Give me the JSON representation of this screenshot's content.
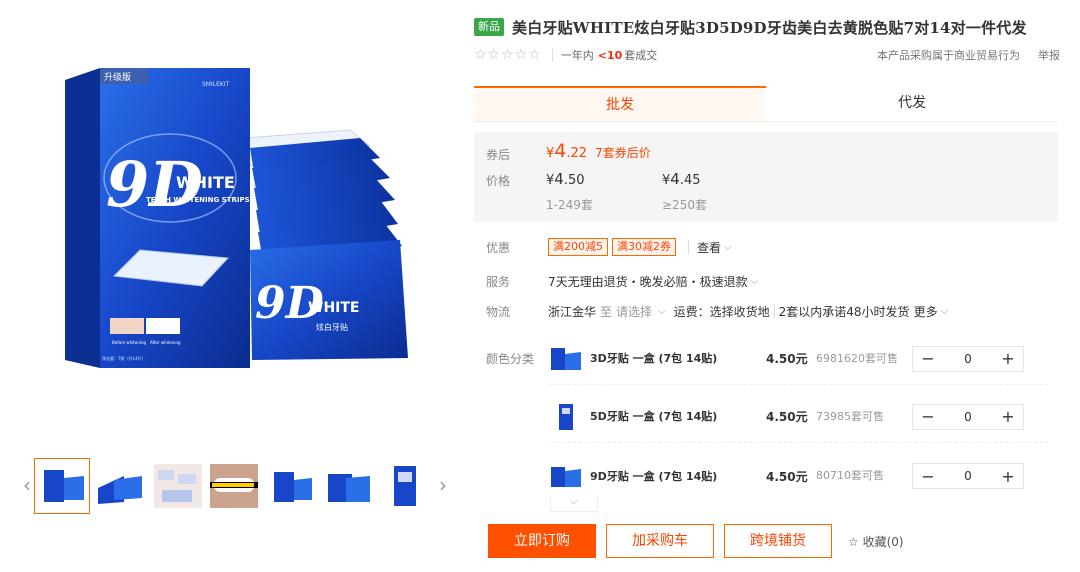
{
  "product": {
    "new_badge": "新品",
    "title": "美白牙贴WHITE炫白牙贴3D5D9D牙齿美白去黄脱色贴7对14对一件代发"
  },
  "rating": {
    "stars": "☆☆☆☆☆",
    "deals_prefix": "一年内",
    "deals_count": "<10",
    "deals_suffix": "套成交",
    "trade_note": "本产品采购属于商业贸易行为",
    "report": "举报"
  },
  "tabs": [
    {
      "label": "批发",
      "active": true
    },
    {
      "label": "代发",
      "active": false
    }
  ],
  "price": {
    "coupon_label": "券后",
    "coupon_currency": "¥",
    "coupon_int": "4",
    "coupon_dec": ".22",
    "coupon_note": "7套券后价",
    "price_label": "价格",
    "tiers": [
      {
        "currency": "¥",
        "int": "4",
        "dec": ".50",
        "qty": "1-249套"
      },
      {
        "currency": "¥",
        "int": "4",
        "dec": ".45",
        "qty": "≥250套"
      }
    ]
  },
  "promo": {
    "label": "优惠",
    "tags": [
      "满200减5",
      "满30减2券"
    ],
    "view": "查看"
  },
  "service": {
    "label": "服务",
    "text": "7天无理由退货・晚发必赔・极速退款"
  },
  "logistics": {
    "label": "物流",
    "origin": "浙江金华",
    "to": "至",
    "select": "请选择",
    "fee": "运费：选择收货地",
    "ship": "2套以内承诺48小时发货",
    "more": "更多"
  },
  "variants": {
    "label": "颜色分类",
    "items": [
      {
        "name": "3D牙贴 一盒 (7包 14贴)",
        "price": "4.50元",
        "stock": "6981620套可售",
        "qty": "0"
      },
      {
        "name": "5D牙贴 一盒 (7包 14贴)",
        "price": "4.50元",
        "stock": "73985套可售",
        "qty": "0"
      },
      {
        "name": "9D牙贴 一盒 (7包 14贴)",
        "price": "4.50元",
        "stock": "80710套可售",
        "qty": "0"
      }
    ]
  },
  "actions": {
    "buy_now": "立即订购",
    "add_cart": "加采购车",
    "cross_border": "跨境铺货",
    "favorite": "收藏(0)"
  },
  "product_image": {
    "upgrade_label": "升级版",
    "brand": "SMILEKIT",
    "big_text": "9D",
    "white_text": "WHITE",
    "sub_text": "TEETH WHITENING STRIPS",
    "zh_text": "炫白牙贴",
    "before_label": "Before whitening",
    "after_label": "After whitening",
    "net_content": "净含量：7袋（共14片）"
  },
  "colors": {
    "accent": "#ff5000",
    "new_green": "#3aa64a",
    "box_blue": "#1747c8"
  }
}
